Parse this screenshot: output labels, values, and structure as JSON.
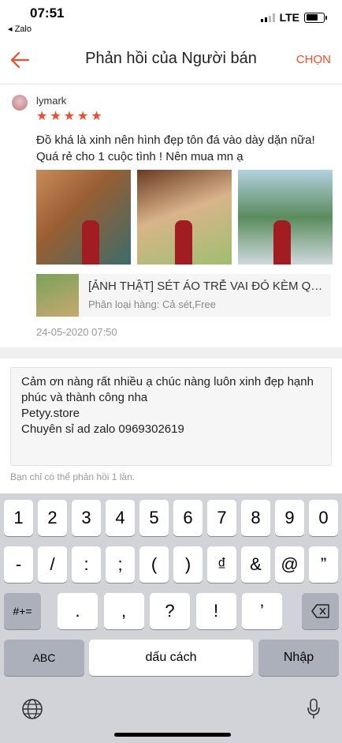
{
  "status_bar": {
    "time": "07:51",
    "back_app": "◂ Zalo",
    "network": "LTE"
  },
  "navbar": {
    "title": "Phản hồi của Người bán",
    "action": "CHỌN"
  },
  "review": {
    "username": "lymark",
    "rating": 5,
    "text": "Đồ khá là xinh nên hình đẹp tôn đá vào dày dặn nữa! Quá rẻ cho 1 cuộc tình ! Nên mua mn ạ",
    "photo_count": 3,
    "product": {
      "name": "[ẢNH THẬT] SÉT ÁO TRỄ VAI ĐỎ KÈM QU...",
      "variation": "Phân loại hàng: Cả sét,Free"
    },
    "date": "24-05-2020 07:50"
  },
  "reply": {
    "text": "Cảm ơn nàng rất nhiều ạ chúc nàng luôn xinh đẹp hạnh phúc và thành công nha\nPetyy.store\nChuyên sỉ ad zalo 0969302619",
    "hint": "Bạn chỉ có thể phản hồi 1 lần."
  },
  "keyboard": {
    "row1": [
      "1",
      "2",
      "3",
      "4",
      "5",
      "6",
      "7",
      "8",
      "9",
      "0"
    ],
    "row2": [
      "-",
      "/",
      ":",
      ";",
      "(",
      ")",
      "₫",
      "&",
      "@",
      "”"
    ],
    "row3": [
      ".",
      ",",
      "?",
      "!",
      "’"
    ],
    "symbols_key": "#+=",
    "abc_key": "ABC",
    "space_key": "dấu cách",
    "return_key": "Nhập"
  },
  "colors": {
    "accent": "#ee4d2d"
  }
}
